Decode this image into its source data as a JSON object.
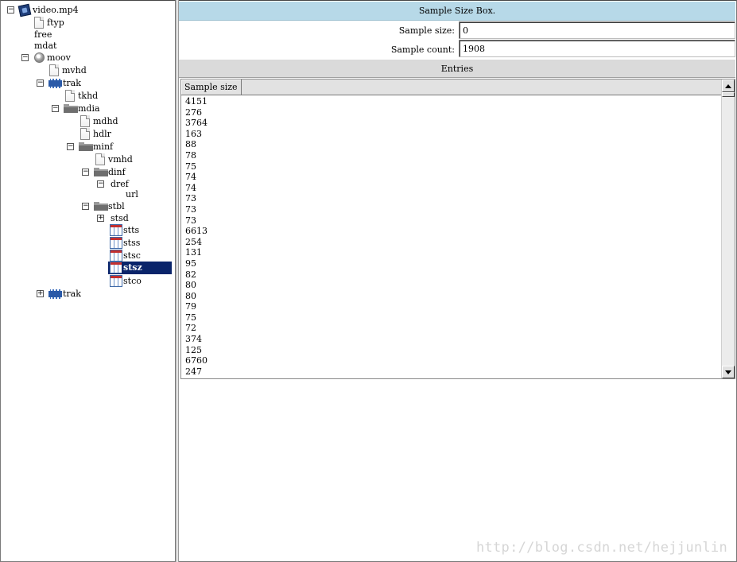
{
  "tree": {
    "root": "video.mp4",
    "nodes": {
      "ftyp": "ftyp",
      "free": "free",
      "mdat": "mdat",
      "moov": "moov",
      "mvhd": "mvhd",
      "trak1": "trak",
      "tkhd": "tkhd",
      "mdia": "mdia",
      "mdhd": "mdhd",
      "hdlr": "hdlr",
      "minf": "minf",
      "vmhd": "vmhd",
      "dinf": "dinf",
      "dref": "dref",
      "url": "url",
      "stbl": "stbl",
      "stsd": "stsd",
      "stts": "stts",
      "stss": "stss",
      "stsc": "stsc",
      "stsz": "stsz",
      "stco": "stco",
      "trak2": "trak"
    },
    "selected": "stsz",
    "toggles": {
      "expanded": "−",
      "collapsed": "+"
    }
  },
  "box": {
    "title": "Sample Size Box.",
    "sample_size_label": "Sample size:",
    "sample_size_value": "0",
    "sample_count_label": "Sample count:",
    "sample_count_value": "1908"
  },
  "entries": {
    "title": "Entries",
    "column_header": "Sample size",
    "rows": [
      "4151",
      "276",
      "3764",
      "163",
      "88",
      "78",
      "75",
      "74",
      "74",
      "73",
      "73",
      "73",
      "6613",
      "254",
      "131",
      "95",
      "82",
      "80",
      "80",
      "79",
      "75",
      "72",
      "374",
      "125",
      "6760",
      "247"
    ]
  },
  "watermark": "http://blog.csdn.net/hejjunlin",
  "colors": {
    "title_bar": "#b7d9e8",
    "selection": "#0a246a"
  }
}
